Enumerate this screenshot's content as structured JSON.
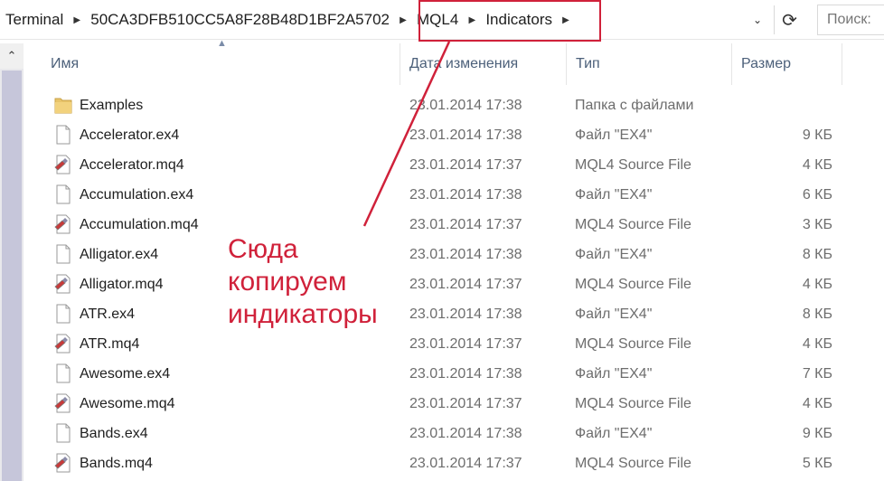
{
  "breadcrumb": {
    "items": [
      "Terminal",
      "50CA3DFB510CC5A8F28B48D1BF2A5702",
      "MQL4",
      "Indicators"
    ]
  },
  "search": {
    "placeholder": "Поиск:"
  },
  "columns": {
    "name": "Имя",
    "date": "Дата изменения",
    "type": "Тип",
    "size": "Размер"
  },
  "files": [
    {
      "name": "Examples",
      "date": "23.01.2014 17:38",
      "type": "Папка с файлами",
      "size": "",
      "icon": "folder-icon"
    },
    {
      "name": "Accelerator.ex4",
      "date": "23.01.2014 17:38",
      "type": "Файл \"EX4\"",
      "size": "9 КБ",
      "icon": "file-icon"
    },
    {
      "name": "Accelerator.mq4",
      "date": "23.01.2014 17:37",
      "type": "MQL4 Source File",
      "size": "4 КБ",
      "icon": "mq4-file-icon"
    },
    {
      "name": "Accumulation.ex4",
      "date": "23.01.2014 17:38",
      "type": "Файл \"EX4\"",
      "size": "6 КБ",
      "icon": "file-icon"
    },
    {
      "name": "Accumulation.mq4",
      "date": "23.01.2014 17:37",
      "type": "MQL4 Source File",
      "size": "3 КБ",
      "icon": "mq4-file-icon"
    },
    {
      "name": "Alligator.ex4",
      "date": "23.01.2014 17:38",
      "type": "Файл \"EX4\"",
      "size": "8 КБ",
      "icon": "file-icon"
    },
    {
      "name": "Alligator.mq4",
      "date": "23.01.2014 17:37",
      "type": "MQL4 Source File",
      "size": "4 КБ",
      "icon": "mq4-file-icon"
    },
    {
      "name": "ATR.ex4",
      "date": "23.01.2014 17:38",
      "type": "Файл \"EX4\"",
      "size": "8 КБ",
      "icon": "file-icon"
    },
    {
      "name": "ATR.mq4",
      "date": "23.01.2014 17:37",
      "type": "MQL4 Source File",
      "size": "4 КБ",
      "icon": "mq4-file-icon"
    },
    {
      "name": "Awesome.ex4",
      "date": "23.01.2014 17:38",
      "type": "Файл \"EX4\"",
      "size": "7 КБ",
      "icon": "file-icon"
    },
    {
      "name": "Awesome.mq4",
      "date": "23.01.2014 17:37",
      "type": "MQL4 Source File",
      "size": "4 КБ",
      "icon": "mq4-file-icon"
    },
    {
      "name": "Bands.ex4",
      "date": "23.01.2014 17:38",
      "type": "Файл \"EX4\"",
      "size": "9 КБ",
      "icon": "file-icon"
    },
    {
      "name": "Bands.mq4",
      "date": "23.01.2014 17:37",
      "type": "MQL4 Source File",
      "size": "5 КБ",
      "icon": "mq4-file-icon"
    }
  ],
  "annotation": {
    "lines": [
      "Сюда",
      "копируем",
      "индикаторы"
    ],
    "color": "#d0213a"
  },
  "icons": {
    "breadcrumb_separator": "chevron-right-icon",
    "dropdown": "chevron-down-icon",
    "refresh": "refresh-icon",
    "scroll_up": "scroll-up-arrow-icon",
    "sort": "sort-ascending-icon"
  }
}
